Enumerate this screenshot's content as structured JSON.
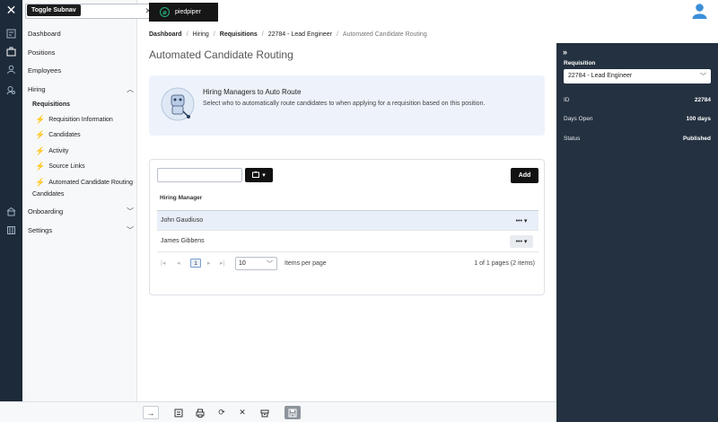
{
  "subnav": {
    "tooltip": "Toggle Subnav",
    "search_value": "",
    "items": [
      {
        "label": "Dashboard"
      },
      {
        "label": "Positions"
      },
      {
        "label": "Employees"
      },
      {
        "label": "Hiring"
      },
      {
        "label": "Onboarding"
      },
      {
        "label": "Settings"
      }
    ],
    "hiring_sub": {
      "requisitions": "Requisitions",
      "candidates": "Candidates",
      "links": [
        {
          "label": "Requisition Information"
        },
        {
          "label": "Candidates"
        },
        {
          "label": "Activity"
        },
        {
          "label": "Source Links"
        },
        {
          "label": "Automated Candidate Routing"
        }
      ]
    }
  },
  "header": {
    "brand": "piedpiper"
  },
  "breadcrumb": [
    {
      "label": "Dashboard"
    },
    {
      "label": "Hiring"
    },
    {
      "label": "Requisitions"
    },
    {
      "label": "22784 - Lead Engineer"
    },
    {
      "label": "Automated Candidate Routing"
    }
  ],
  "page_title": "Automated Candidate Routing",
  "info": {
    "title": "Hiring Managers to Auto Route",
    "description": "Select who to automatically route candidates to when applying for a requisition based on this position."
  },
  "table": {
    "add_label": "Add",
    "column_header": "Hiring Manager",
    "rows": [
      {
        "name": "John Gaudiuso",
        "actions": "•••"
      },
      {
        "name": "James Gibbens",
        "actions": "•••"
      }
    ],
    "pager": {
      "current_page": "1",
      "page_size": "10",
      "items_per_page_label": "Items per page",
      "info": "1 of 1 pages (2 items)"
    }
  },
  "right_panel": {
    "requisition_label": "Requisition",
    "requisition_value": "22784 - Lead Engineer",
    "fields": [
      {
        "key": "ID",
        "value": "22784"
      },
      {
        "key": "Days Open",
        "value": "100 days"
      },
      {
        "key": "Status",
        "value": "Published"
      }
    ]
  }
}
